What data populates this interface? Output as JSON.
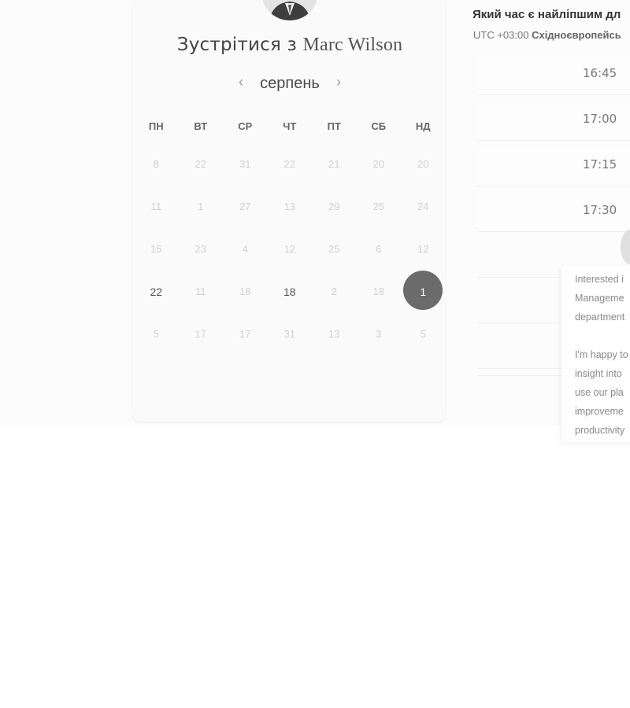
{
  "calendar": {
    "title_prefix": "Зустрітися з",
    "host_name": "Marc Wilson",
    "prev_arrow": "‹",
    "next_arrow": "›",
    "month": "серпень",
    "weekdays": [
      "ПН",
      "ВТ",
      "СР",
      "ЧТ",
      "ПТ",
      "СБ",
      "НД"
    ],
    "weeks": [
      [
        {
          "d": "8",
          "s": "off"
        },
        {
          "d": "22",
          "s": "off"
        },
        {
          "d": "31",
          "s": "off"
        },
        {
          "d": "22",
          "s": "off"
        },
        {
          "d": "21",
          "s": "off"
        },
        {
          "d": "20",
          "s": "off"
        },
        {
          "d": "20",
          "s": "off"
        }
      ],
      [
        {
          "d": "11",
          "s": "off"
        },
        {
          "d": "1",
          "s": "off"
        },
        {
          "d": "27",
          "s": "off"
        },
        {
          "d": "13",
          "s": "off"
        },
        {
          "d": "29",
          "s": "off"
        },
        {
          "d": "25",
          "s": "off"
        },
        {
          "d": "24",
          "s": "off"
        }
      ],
      [
        {
          "d": "15",
          "s": "off"
        },
        {
          "d": "23",
          "s": "off"
        },
        {
          "d": "4",
          "s": "off"
        },
        {
          "d": "12",
          "s": "off"
        },
        {
          "d": "25",
          "s": "off"
        },
        {
          "d": "6",
          "s": "off"
        },
        {
          "d": "12",
          "s": "off"
        }
      ],
      [
        {
          "d": "22",
          "s": "avail"
        },
        {
          "d": "11",
          "s": "off"
        },
        {
          "d": "18",
          "s": "off"
        },
        {
          "d": "18",
          "s": "avail"
        },
        {
          "d": "2",
          "s": "off"
        },
        {
          "d": "18",
          "s": "off"
        },
        {
          "d": "1",
          "s": "selected"
        }
      ],
      [
        {
          "d": "5",
          "s": "off"
        },
        {
          "d": "17",
          "s": "off"
        },
        {
          "d": "17",
          "s": "off"
        },
        {
          "d": "31",
          "s": "off"
        },
        {
          "d": "13",
          "s": "off"
        },
        {
          "d": "3",
          "s": "off"
        },
        {
          "d": "5",
          "s": "off"
        }
      ]
    ]
  },
  "times": {
    "question": "Який час є найліпшим дл",
    "tz_offset": "UTC +03:00",
    "tz_name": "Східноєвропейсь",
    "slots": [
      "16:45",
      "17:00",
      "17:15",
      "17:30"
    ]
  },
  "note": {
    "lines": [
      "Interested i",
      "Manageme",
      "department",
      "",
      "I'm happy to",
      "insight into",
      "use our pla",
      "improveme",
      "productivity"
    ]
  }
}
